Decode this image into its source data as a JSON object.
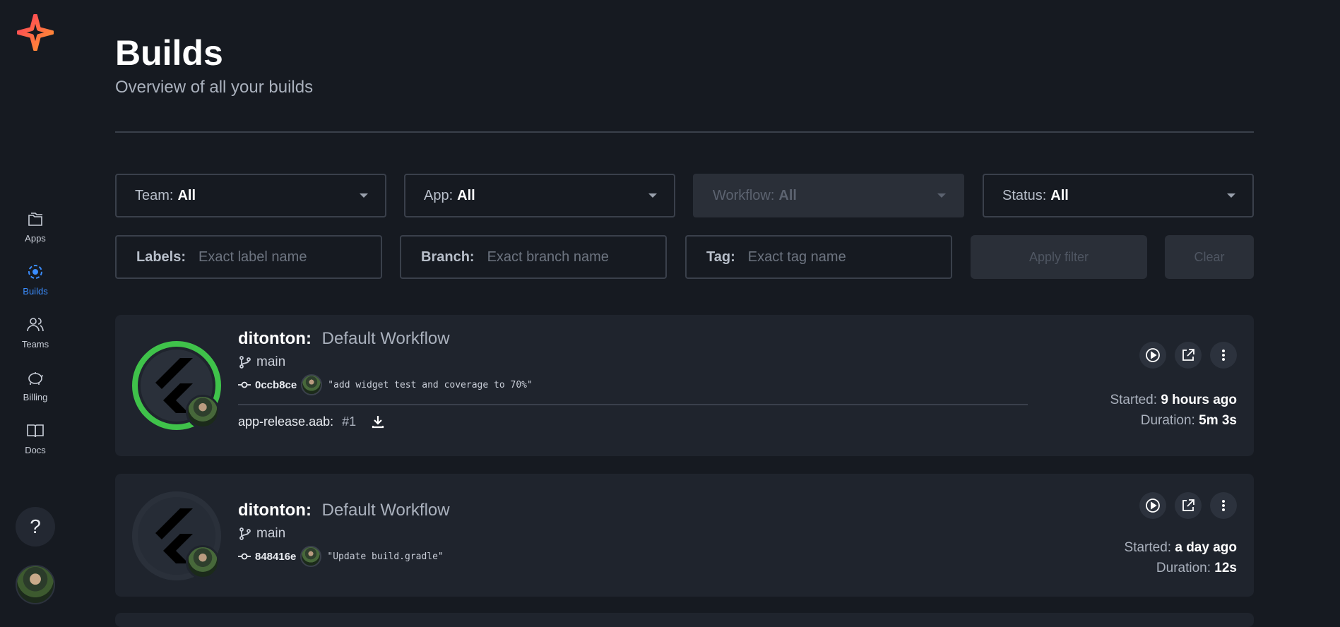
{
  "sidebar": {
    "items": [
      {
        "label": "Apps",
        "icon": "folders-icon"
      },
      {
        "label": "Builds",
        "icon": "builds-icon",
        "active": true
      },
      {
        "label": "Teams",
        "icon": "team-icon"
      },
      {
        "label": "Billing",
        "icon": "piggy-bank-icon"
      },
      {
        "label": "Docs",
        "icon": "book-icon"
      }
    ],
    "help_label": "?"
  },
  "header": {
    "title": "Builds",
    "subtitle": "Overview of all your builds"
  },
  "filters": {
    "team": {
      "label": "Team:",
      "value": "All"
    },
    "app": {
      "label": "App:",
      "value": "All"
    },
    "workflow": {
      "label": "Workflow:",
      "value": "All",
      "disabled": true
    },
    "status": {
      "label": "Status:",
      "value": "All"
    },
    "labels": {
      "label": "Labels:",
      "placeholder": "Exact label name"
    },
    "branch": {
      "label": "Branch:",
      "placeholder": "Exact branch name"
    },
    "tag": {
      "label": "Tag:",
      "placeholder": "Exact tag name"
    },
    "apply_label": "Apply filter",
    "clear_label": "Clear"
  },
  "builds": [
    {
      "app": "ditonton:",
      "workflow": "Default Workflow",
      "branch": "main",
      "commit_hash": "0ccb8ce",
      "commit_message": "\"add widget test and coverage to 70%\"",
      "artifact_name": "app-release.aab:",
      "artifact_num": "#1",
      "started_label": "Started:",
      "started": "9 hours ago",
      "duration_label": "Duration:",
      "duration": "5m 3s",
      "status_color": "#3fc24a"
    },
    {
      "app": "ditonton:",
      "workflow": "Default Workflow",
      "branch": "main",
      "commit_hash": "848416e",
      "commit_message": "\"Update build.gradle\"",
      "started_label": "Started:",
      "started": "a day ago",
      "duration_label": "Duration:",
      "duration": "12s",
      "status_color": "#2a303a"
    }
  ],
  "colors": {
    "background": "#161a21",
    "card": "#1f242d",
    "accent": "#3b8dff",
    "success": "#3fc24a"
  }
}
